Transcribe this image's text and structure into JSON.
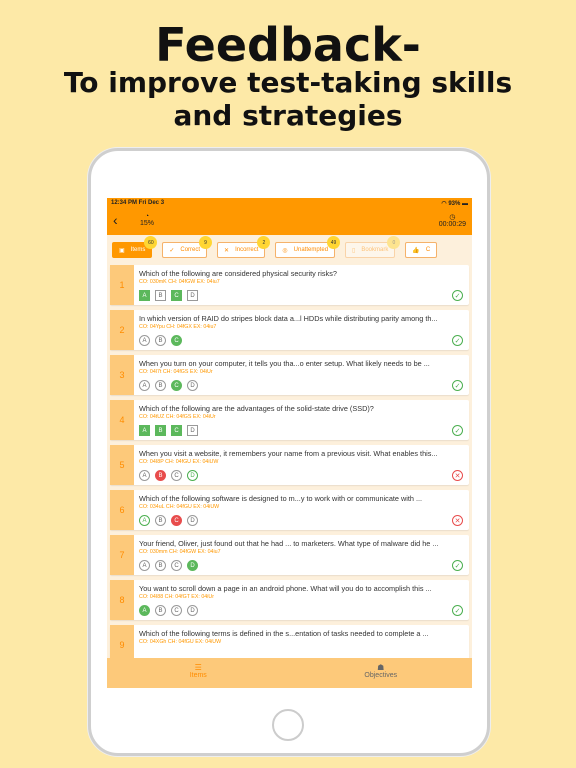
{
  "promo": {
    "title": "Feedback-",
    "subtitle_line1": "To improve test-taking skills",
    "subtitle_line2": "and strategies"
  },
  "status": {
    "time": "12:34 PM  Fri Dec 3",
    "battery": "93%"
  },
  "header": {
    "progress": "15%",
    "timer": "00:00:29"
  },
  "filters": [
    {
      "label": "Items",
      "count": "60",
      "icon": "list-icon",
      "state": "active"
    },
    {
      "label": "Correct",
      "count": "9",
      "icon": "check-icon",
      "state": ""
    },
    {
      "label": "Incorrect",
      "count": "2",
      "icon": "x-icon",
      "state": ""
    },
    {
      "label": "Unattempted",
      "count": "49",
      "icon": "eye-slash-icon",
      "state": ""
    },
    {
      "label": "Bookmark",
      "count": "0",
      "icon": "bookmark-icon",
      "state": "dis"
    },
    {
      "label": "C",
      "count": "",
      "icon": "thumbs-up-icon",
      "state": ""
    }
  ],
  "items": [
    {
      "n": "1",
      "q": "Which of the following are considered physical security risks?",
      "meta": "CO: 030mK CH: 04fGW EX: 04iu7",
      "shape": "square",
      "opts": [
        [
          "A",
          "correct"
        ],
        [
          "B",
          ""
        ],
        [
          "C",
          "correct"
        ],
        [
          "D",
          ""
        ]
      ],
      "result": "correct"
    },
    {
      "n": "2",
      "q": "In which version of RAID do stripes block data a...l HDDs while distributing parity among th...",
      "meta": "CO: 04Ypu CH: 04fGX EX: 04iu7",
      "shape": "circle",
      "opts": [
        [
          "A",
          ""
        ],
        [
          "B",
          ""
        ],
        [
          "C",
          "correct"
        ]
      ],
      "result": "correct"
    },
    {
      "n": "3",
      "q": "When you turn on your computer, it tells you tha...o enter setup. What likely needs to be ...",
      "meta": "CO: 04l7t CH: 04fGS EX: 04iUr",
      "shape": "circle",
      "opts": [
        [
          "A",
          ""
        ],
        [
          "B",
          ""
        ],
        [
          "C",
          "correct"
        ],
        [
          "D",
          ""
        ]
      ],
      "result": "correct"
    },
    {
      "n": "4",
      "q": "Which of the following are the advantages of the solid-state drive (SSD)?",
      "meta": "CO: 04tUZ CH: 04fGS EX: 04iUr",
      "shape": "square",
      "opts": [
        [
          "A",
          "correct"
        ],
        [
          "B",
          "correct"
        ],
        [
          "C",
          "correct"
        ],
        [
          "D",
          ""
        ]
      ],
      "result": "correct"
    },
    {
      "n": "5",
      "q": "When you visit a website, it remembers your name from a previous visit. What enables this...",
      "meta": "CO: 04I8P CH: 04fGU EX: 04iUW",
      "shape": "circle",
      "opts": [
        [
          "A",
          ""
        ],
        [
          "B",
          "wrong"
        ],
        [
          "C",
          ""
        ],
        [
          "D",
          "missed"
        ]
      ],
      "result": "wrong"
    },
    {
      "n": "6",
      "q": "Which of the following software is designed to m...y to work with or communicate with ...",
      "meta": "CO: 034uL CH: 04fGU EX: 04iUW",
      "shape": "circle",
      "opts": [
        [
          "A",
          "missed"
        ],
        [
          "B",
          ""
        ],
        [
          "C",
          "wrong"
        ],
        [
          "D",
          ""
        ]
      ],
      "result": "wrong"
    },
    {
      "n": "7",
      "q": "Your friend, Oliver, just found out that he had ... to marketers. What type of malware did he ...",
      "meta": "CO: 030mm CH: 04fGW EX: 04iu7",
      "shape": "circle",
      "opts": [
        [
          "A",
          ""
        ],
        [
          "B",
          ""
        ],
        [
          "C",
          ""
        ],
        [
          "D",
          "correct"
        ]
      ],
      "result": "correct"
    },
    {
      "n": "8",
      "q": "You want to scroll down a page in an android phone. What will you do to accomplish this ...",
      "meta": "CO: 04I88 CH: 04fGT EX: 04iUr",
      "shape": "circle",
      "opts": [
        [
          "A",
          "correct"
        ],
        [
          "B",
          ""
        ],
        [
          "C",
          ""
        ],
        [
          "D",
          ""
        ]
      ],
      "result": "correct"
    },
    {
      "n": "9",
      "q": "Which of the following terms is defined in the s...entation of tasks needed to complete a ...",
      "meta": "CO: 04XGh CH: 04fGU EX: 04iUW",
      "shape": "circle",
      "opts": [],
      "result": ""
    }
  ],
  "tabs": [
    {
      "label": "Items",
      "icon": "list-icon"
    },
    {
      "label": "Objectives",
      "icon": "brain-icon"
    }
  ],
  "colors": {
    "accent": "#ff9800",
    "correct": "#5cb85c",
    "wrong": "#e84c4c",
    "background": "#fde9a7"
  }
}
